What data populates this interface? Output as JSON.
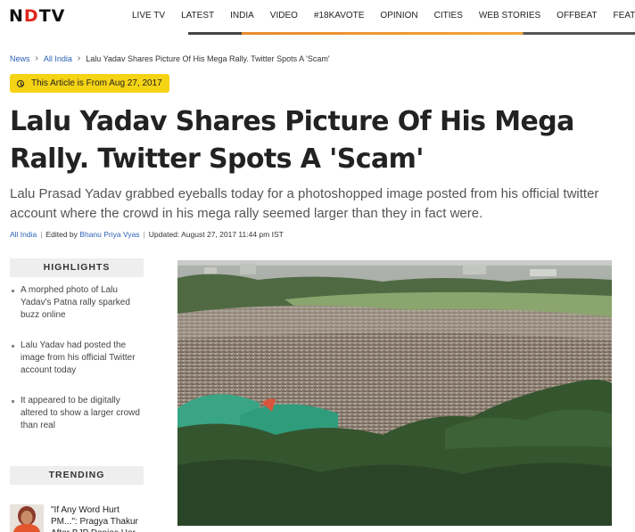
{
  "header": {
    "logo_text": "NDTV",
    "nav_items": [
      "LIVE TV",
      "LATEST",
      "INDIA",
      "VIDEO",
      "#18KAVOTE",
      "OPINION",
      "CITIES",
      "WEB STORIES",
      "OFFBEAT",
      "FEATURE"
    ]
  },
  "breadcrumb": {
    "items": [
      "News",
      "All India"
    ],
    "current": "Lalu Yadav Shares Picture Of His Mega Rally. Twitter Spots A 'Scam'"
  },
  "badge": {
    "text": "This Article is From Aug 27, 2017"
  },
  "article": {
    "headline": "Lalu Yadav Shares Picture Of His Mega Rally. Twitter Spots A 'Scam'",
    "summary": "Lalu Prasad Yadav grabbed eyeballs today for a photoshopped image posted from his official twitter account where the crowd in his mega rally seemed larger than they in fact were.",
    "category": "All India",
    "edited_label": "Edited by",
    "editor": "Bhanu Priya Vyas",
    "updated": "Updated: August 27, 2017 11:44 pm IST"
  },
  "highlights": {
    "title": "HIGHLIGHTS",
    "items": [
      "A morphed photo of Lalu Yadav's Patna rally sparked buzz online",
      "Lalu Yadav had posted the image from his official Twitter account today",
      "It appeared to be digitally altered to show a larger crowd than real"
    ]
  },
  "trending": {
    "title": "TRENDING",
    "items": [
      {
        "title": "\"If Any Word Hurt PM...\": Pragya Thakur After BJP Denies Her"
      }
    ]
  },
  "colors": {
    "accent_red": "#e1261c",
    "link_blue": "#2b62b5",
    "badge_yellow": "#f5d315",
    "accent_orange": "#f3a33a"
  }
}
